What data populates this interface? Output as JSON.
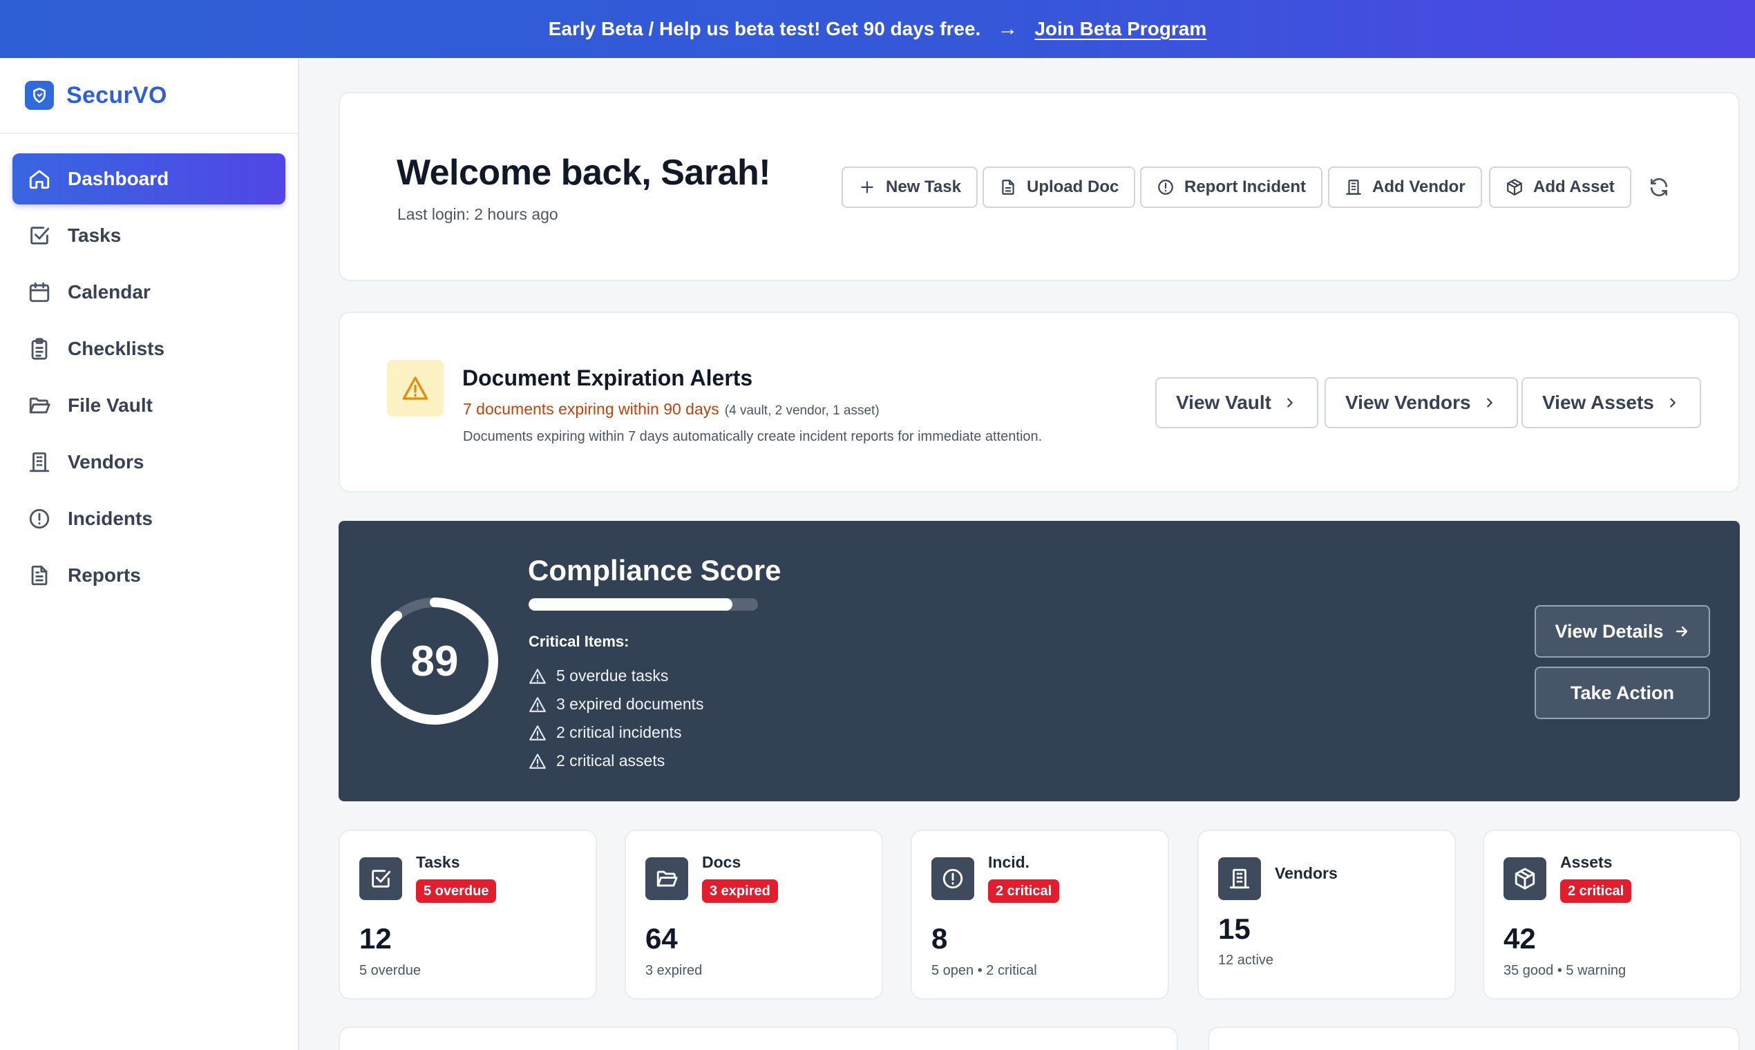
{
  "banner": {
    "text": "Early Beta / Help us beta test! Get 90 days free.",
    "arrow": "→",
    "link": "Join Beta Program"
  },
  "sidebar": {
    "brand": "SecurVO",
    "items": [
      {
        "label": "Dashboard",
        "icon": "home-icon",
        "active": true
      },
      {
        "label": "Tasks",
        "icon": "checkbox-icon"
      },
      {
        "label": "Calendar",
        "icon": "calendar-icon"
      },
      {
        "label": "Checklists",
        "icon": "clipboard-list-icon"
      },
      {
        "label": "File Vault",
        "icon": "folder-open-icon"
      },
      {
        "label": "Vendors",
        "icon": "building-icon"
      },
      {
        "label": "Incidents",
        "icon": "alert-circle-icon"
      },
      {
        "label": "Reports",
        "icon": "file-text-icon"
      }
    ]
  },
  "welcome": {
    "title": "Welcome back, Sarah!",
    "last_login": "Last login: 2 hours ago",
    "actions": [
      "New Task",
      "Upload Doc",
      "Report Incident",
      "Add Vendor",
      "Add Asset"
    ]
  },
  "alerts": {
    "title": "Document Expiration Alerts",
    "summary": "7 documents expiring within 90 days",
    "breakdown": "(4 vault, 2 vendor, 1 asset)",
    "note": "Documents expiring within 7 days automatically create incident reports for immediate attention.",
    "buttons": [
      "View Vault",
      "View Vendors",
      "View Assets"
    ]
  },
  "compliance": {
    "title": "Compliance Score",
    "score": "89",
    "score_fraction": 0.89,
    "critical_title": "Critical Items:",
    "critical_items": [
      "5 overdue tasks",
      "3 expired documents",
      "2 critical incidents",
      "2 critical assets"
    ],
    "view_details": "View Details",
    "take_action": "Take Action"
  },
  "stats": [
    {
      "label": "Tasks",
      "badge": "5 overdue",
      "value": "12",
      "foot": "5 overdue",
      "icon": "checkbox-icon"
    },
    {
      "label": "Docs",
      "badge": "3 expired",
      "value": "64",
      "foot": "3 expired",
      "icon": "folder-open-icon"
    },
    {
      "label": "Incid.",
      "badge": "2 critical",
      "value": "8",
      "foot": "5 open • 2 critical",
      "icon": "alert-circle-icon"
    },
    {
      "label": "Vendors",
      "value": "15",
      "foot": "12 active",
      "icon": "building-icon"
    },
    {
      "label": "Assets",
      "badge": "2 critical",
      "value": "42",
      "foot": "35 good • 5 warning",
      "icon": "package-icon"
    }
  ],
  "colors": {
    "accent": "#3458d8",
    "badge_red": "#e11d2e",
    "score_panel": "#334155",
    "warning": "#f59e0b"
  }
}
